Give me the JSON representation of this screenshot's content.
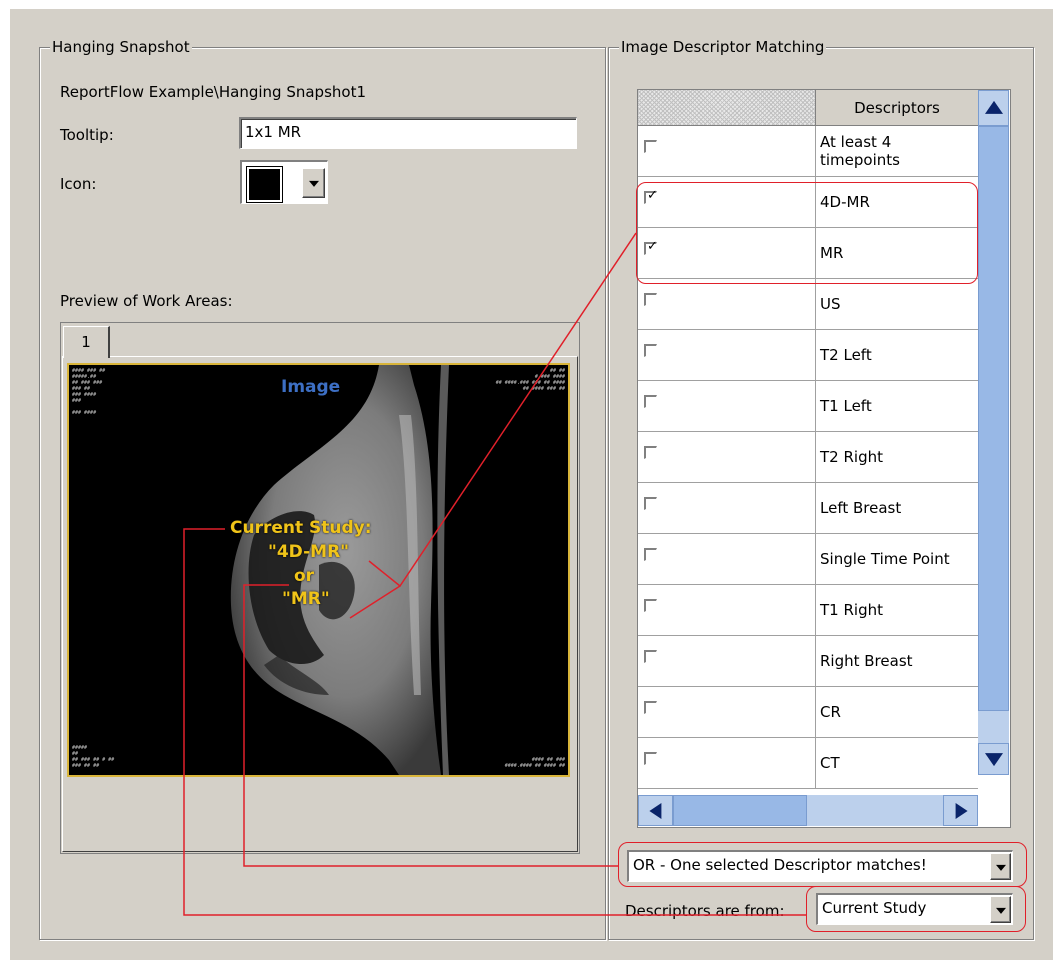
{
  "hanging_snapshot": {
    "group_title": "Hanging Snapshot",
    "path": "ReportFlow Example\\Hanging Snapshot1",
    "tooltip_label": "Tooltip:",
    "tooltip_value": "1x1 MR",
    "icon_label": "Icon:",
    "preview_label": "Preview of Work Areas:",
    "tabs": [
      "1"
    ],
    "preview": {
      "title": "Image",
      "annotation_lines": [
        "Current Study:",
        "\"4D-MR\"",
        "or",
        "\"MR\""
      ]
    }
  },
  "image_descriptor_matching": {
    "group_title": "Image Descriptor Matching",
    "column_header": "Descriptors",
    "rows": [
      {
        "label": "At least 4 timepoints",
        "checked": false
      },
      {
        "label": "4D-MR",
        "checked": true
      },
      {
        "label": "MR",
        "checked": true
      },
      {
        "label": "US",
        "checked": false
      },
      {
        "label": "T2 Left",
        "checked": false
      },
      {
        "label": "T1 Left",
        "checked": false
      },
      {
        "label": "T2 Right",
        "checked": false
      },
      {
        "label": "Left Breast",
        "checked": false
      },
      {
        "label": "Single Time Point",
        "checked": false
      },
      {
        "label": "T1 Right",
        "checked": false
      },
      {
        "label": "Right Breast",
        "checked": false
      },
      {
        "label": "CR",
        "checked": false
      },
      {
        "label": "CT",
        "checked": false
      }
    ],
    "match_mode": "OR - One selected Descriptor matches!",
    "source_label": "Descriptors are from:",
    "source_value": "Current Study"
  },
  "colors": {
    "dialog_bg": "#d4d0c8",
    "callout_red": "#e0202a",
    "annotation_yellow": "#f0c419",
    "scrollbar_blue": "#98b8e6"
  }
}
